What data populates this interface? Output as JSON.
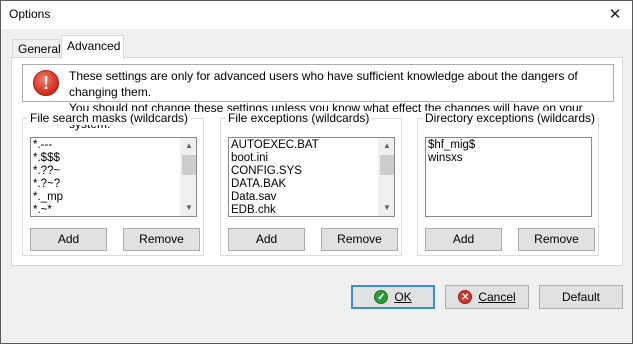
{
  "window": {
    "title": "Options",
    "close_glyph": "✕"
  },
  "tabs": [
    {
      "label": "General"
    },
    {
      "label": "Advanced"
    }
  ],
  "warning": {
    "icon": "!",
    "line1": "These settings are only for advanced users who have sufficient knowledge about the dangers of changing them.",
    "line2": "You should not change these settings unless you know what effect the changes will have on your system."
  },
  "groups": {
    "search_masks": {
      "label": "File search masks (wildcards)",
      "items": [
        "*.---",
        "*.$$$",
        "*.??~",
        "*.?~?",
        "*._mp",
        "*.~*"
      ]
    },
    "file_exceptions": {
      "label": "File exceptions (wildcards)",
      "items": [
        "AUTOEXEC.BAT",
        "boot.ini",
        "CONFIG.SYS",
        "DATA.BAK",
        "Data.sav",
        "EDB.chk"
      ]
    },
    "dir_exceptions": {
      "label": "Directory exceptions (wildcards)",
      "items": [
        "$hf_mig$",
        "winsxs"
      ]
    }
  },
  "buttons": {
    "add": "Add",
    "remove": "Remove",
    "ok": "OK",
    "cancel": "Cancel",
    "default": "Default"
  }
}
